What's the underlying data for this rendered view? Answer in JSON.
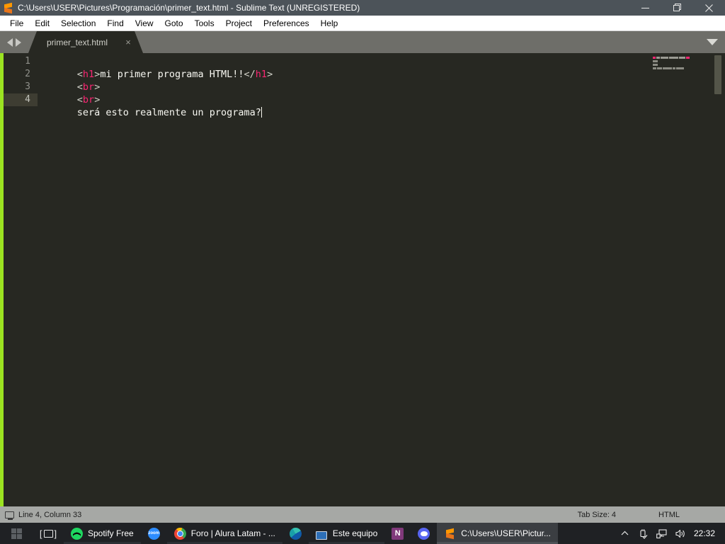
{
  "window": {
    "title": "C:\\Users\\USER\\Pictures\\Programación\\primer_text.html - Sublime Text (UNREGISTERED)",
    "app_icon": "sublime-text-icon",
    "controls": {
      "minimize": "minimize-icon",
      "maximize": "maximize-icon",
      "close": "close-icon"
    }
  },
  "menubar": {
    "items": [
      {
        "label": "File"
      },
      {
        "label": "Edit"
      },
      {
        "label": "Selection"
      },
      {
        "label": "Find"
      },
      {
        "label": "View"
      },
      {
        "label": "Goto"
      },
      {
        "label": "Tools"
      },
      {
        "label": "Project"
      },
      {
        "label": "Preferences"
      },
      {
        "label": "Help"
      }
    ]
  },
  "tabbar": {
    "nav_prev": "arrow-left-icon",
    "nav_next": "arrow-right-icon",
    "menu": "chevron-down-icon",
    "tabs": [
      {
        "label": "primer_text.html",
        "close": "×",
        "active": true
      }
    ]
  },
  "editor": {
    "modified_indicator_color": "#9be321",
    "background": "#272822",
    "active_line": 4,
    "lines": [
      {
        "number": "1",
        "tokens": [
          {
            "text": "<",
            "type": "punct"
          },
          {
            "text": "h1",
            "type": "tag"
          },
          {
            "text": ">",
            "type": "punct"
          },
          {
            "text": "mi primer programa HTML!!",
            "type": "text"
          },
          {
            "text": "</",
            "type": "punct"
          },
          {
            "text": "h1",
            "type": "tag"
          },
          {
            "text": ">",
            "type": "punct"
          }
        ]
      },
      {
        "number": "2",
        "tokens": [
          {
            "text": "<",
            "type": "punct"
          },
          {
            "text": "br",
            "type": "tag"
          },
          {
            "text": ">",
            "type": "punct"
          }
        ]
      },
      {
        "number": "3",
        "tokens": [
          {
            "text": "<",
            "type": "punct"
          },
          {
            "text": "br",
            "type": "tag"
          },
          {
            "text": ">",
            "type": "punct"
          }
        ]
      },
      {
        "number": "4",
        "tokens": [
          {
            "text": "será esto realmente un programa?",
            "type": "text"
          }
        ],
        "caret": true
      }
    ],
    "colors": {
      "punct": "#cfcfc6",
      "tag": "#f92672",
      "text": "#f8f8f2",
      "gutter": "#90918b",
      "active_gutter_bg": "#3e3d32"
    }
  },
  "statusbar": {
    "console_icon": "console-icon",
    "position": "Line 4, Column 33",
    "tab_size": "Tab Size: 4",
    "syntax": "HTML"
  },
  "taskbar": {
    "start": "windows-start-icon",
    "task_view": "task-view-icon",
    "items": [
      {
        "icon": "spotify-icon",
        "label": "Spotify Free",
        "running": true,
        "active": false,
        "labelled": true
      },
      {
        "icon": "zoom-icon",
        "label": "",
        "running": false,
        "active": false,
        "labelled": false
      },
      {
        "icon": "chrome-icon",
        "label": "Foro | Alura Latam - ...",
        "running": true,
        "active": false,
        "labelled": true
      },
      {
        "icon": "edge-icon",
        "label": "",
        "running": false,
        "active": false,
        "labelled": false
      },
      {
        "icon": "this-pc-icon",
        "label": "Este equipo",
        "running": true,
        "active": false,
        "labelled": true
      },
      {
        "icon": "onenote-icon",
        "label": "",
        "running": false,
        "active": false,
        "labelled": false
      },
      {
        "icon": "discord-icon",
        "label": "",
        "running": false,
        "active": false,
        "labelled": false
      },
      {
        "icon": "sublime-text-icon",
        "label": "C:\\Users\\USER\\Pictur...",
        "running": true,
        "active": true,
        "labelled": true
      }
    ],
    "tray": [
      {
        "icon": "chevron-up-icon",
        "name": "show-hidden-icons"
      },
      {
        "icon": "usb-eject-icon",
        "name": "safely-remove-hardware"
      },
      {
        "icon": "network-icon",
        "name": "network-status"
      },
      {
        "icon": "speaker-icon",
        "name": "volume"
      }
    ],
    "clock": "22:32"
  }
}
